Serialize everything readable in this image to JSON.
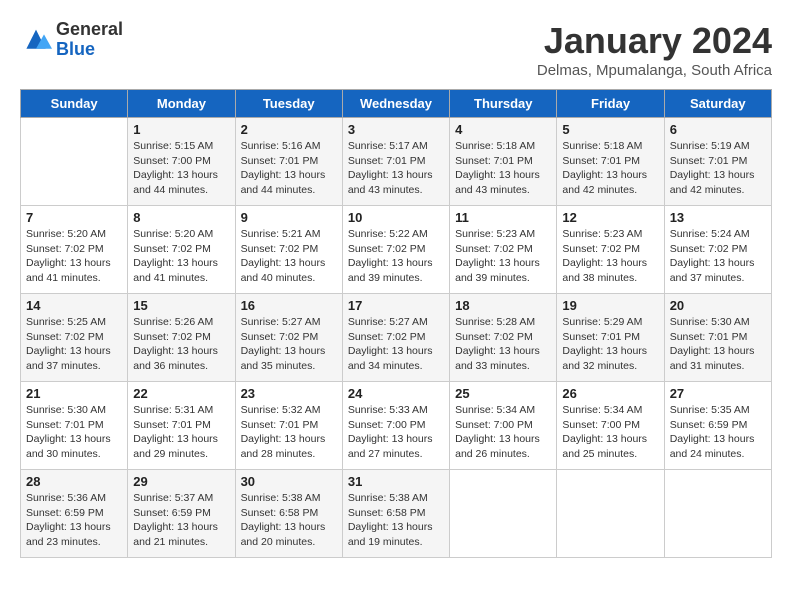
{
  "logo": {
    "general": "General",
    "blue": "Blue"
  },
  "title": "January 2024",
  "location": "Delmas, Mpumalanga, South Africa",
  "days_of_week": [
    "Sunday",
    "Monday",
    "Tuesday",
    "Wednesday",
    "Thursday",
    "Friday",
    "Saturday"
  ],
  "weeks": [
    [
      {
        "day": "",
        "sunrise": "",
        "sunset": "",
        "daylight": ""
      },
      {
        "day": "1",
        "sunrise": "Sunrise: 5:15 AM",
        "sunset": "Sunset: 7:00 PM",
        "daylight": "Daylight: 13 hours and 44 minutes."
      },
      {
        "day": "2",
        "sunrise": "Sunrise: 5:16 AM",
        "sunset": "Sunset: 7:01 PM",
        "daylight": "Daylight: 13 hours and 44 minutes."
      },
      {
        "day": "3",
        "sunrise": "Sunrise: 5:17 AM",
        "sunset": "Sunset: 7:01 PM",
        "daylight": "Daylight: 13 hours and 43 minutes."
      },
      {
        "day": "4",
        "sunrise": "Sunrise: 5:18 AM",
        "sunset": "Sunset: 7:01 PM",
        "daylight": "Daylight: 13 hours and 43 minutes."
      },
      {
        "day": "5",
        "sunrise": "Sunrise: 5:18 AM",
        "sunset": "Sunset: 7:01 PM",
        "daylight": "Daylight: 13 hours and 42 minutes."
      },
      {
        "day": "6",
        "sunrise": "Sunrise: 5:19 AM",
        "sunset": "Sunset: 7:01 PM",
        "daylight": "Daylight: 13 hours and 42 minutes."
      }
    ],
    [
      {
        "day": "7",
        "sunrise": "Sunrise: 5:20 AM",
        "sunset": "Sunset: 7:02 PM",
        "daylight": "Daylight: 13 hours and 41 minutes."
      },
      {
        "day": "8",
        "sunrise": "Sunrise: 5:20 AM",
        "sunset": "Sunset: 7:02 PM",
        "daylight": "Daylight: 13 hours and 41 minutes."
      },
      {
        "day": "9",
        "sunrise": "Sunrise: 5:21 AM",
        "sunset": "Sunset: 7:02 PM",
        "daylight": "Daylight: 13 hours and 40 minutes."
      },
      {
        "day": "10",
        "sunrise": "Sunrise: 5:22 AM",
        "sunset": "Sunset: 7:02 PM",
        "daylight": "Daylight: 13 hours and 39 minutes."
      },
      {
        "day": "11",
        "sunrise": "Sunrise: 5:23 AM",
        "sunset": "Sunset: 7:02 PM",
        "daylight": "Daylight: 13 hours and 39 minutes."
      },
      {
        "day": "12",
        "sunrise": "Sunrise: 5:23 AM",
        "sunset": "Sunset: 7:02 PM",
        "daylight": "Daylight: 13 hours and 38 minutes."
      },
      {
        "day": "13",
        "sunrise": "Sunrise: 5:24 AM",
        "sunset": "Sunset: 7:02 PM",
        "daylight": "Daylight: 13 hours and 37 minutes."
      }
    ],
    [
      {
        "day": "14",
        "sunrise": "Sunrise: 5:25 AM",
        "sunset": "Sunset: 7:02 PM",
        "daylight": "Daylight: 13 hours and 37 minutes."
      },
      {
        "day": "15",
        "sunrise": "Sunrise: 5:26 AM",
        "sunset": "Sunset: 7:02 PM",
        "daylight": "Daylight: 13 hours and 36 minutes."
      },
      {
        "day": "16",
        "sunrise": "Sunrise: 5:27 AM",
        "sunset": "Sunset: 7:02 PM",
        "daylight": "Daylight: 13 hours and 35 minutes."
      },
      {
        "day": "17",
        "sunrise": "Sunrise: 5:27 AM",
        "sunset": "Sunset: 7:02 PM",
        "daylight": "Daylight: 13 hours and 34 minutes."
      },
      {
        "day": "18",
        "sunrise": "Sunrise: 5:28 AM",
        "sunset": "Sunset: 7:02 PM",
        "daylight": "Daylight: 13 hours and 33 minutes."
      },
      {
        "day": "19",
        "sunrise": "Sunrise: 5:29 AM",
        "sunset": "Sunset: 7:01 PM",
        "daylight": "Daylight: 13 hours and 32 minutes."
      },
      {
        "day": "20",
        "sunrise": "Sunrise: 5:30 AM",
        "sunset": "Sunset: 7:01 PM",
        "daylight": "Daylight: 13 hours and 31 minutes."
      }
    ],
    [
      {
        "day": "21",
        "sunrise": "Sunrise: 5:30 AM",
        "sunset": "Sunset: 7:01 PM",
        "daylight": "Daylight: 13 hours and 30 minutes."
      },
      {
        "day": "22",
        "sunrise": "Sunrise: 5:31 AM",
        "sunset": "Sunset: 7:01 PM",
        "daylight": "Daylight: 13 hours and 29 minutes."
      },
      {
        "day": "23",
        "sunrise": "Sunrise: 5:32 AM",
        "sunset": "Sunset: 7:01 PM",
        "daylight": "Daylight: 13 hours and 28 minutes."
      },
      {
        "day": "24",
        "sunrise": "Sunrise: 5:33 AM",
        "sunset": "Sunset: 7:00 PM",
        "daylight": "Daylight: 13 hours and 27 minutes."
      },
      {
        "day": "25",
        "sunrise": "Sunrise: 5:34 AM",
        "sunset": "Sunset: 7:00 PM",
        "daylight": "Daylight: 13 hours and 26 minutes."
      },
      {
        "day": "26",
        "sunrise": "Sunrise: 5:34 AM",
        "sunset": "Sunset: 7:00 PM",
        "daylight": "Daylight: 13 hours and 25 minutes."
      },
      {
        "day": "27",
        "sunrise": "Sunrise: 5:35 AM",
        "sunset": "Sunset: 6:59 PM",
        "daylight": "Daylight: 13 hours and 24 minutes."
      }
    ],
    [
      {
        "day": "28",
        "sunrise": "Sunrise: 5:36 AM",
        "sunset": "Sunset: 6:59 PM",
        "daylight": "Daylight: 13 hours and 23 minutes."
      },
      {
        "day": "29",
        "sunrise": "Sunrise: 5:37 AM",
        "sunset": "Sunset: 6:59 PM",
        "daylight": "Daylight: 13 hours and 21 minutes."
      },
      {
        "day": "30",
        "sunrise": "Sunrise: 5:38 AM",
        "sunset": "Sunset: 6:58 PM",
        "daylight": "Daylight: 13 hours and 20 minutes."
      },
      {
        "day": "31",
        "sunrise": "Sunrise: 5:38 AM",
        "sunset": "Sunset: 6:58 PM",
        "daylight": "Daylight: 13 hours and 19 minutes."
      },
      {
        "day": "",
        "sunrise": "",
        "sunset": "",
        "daylight": ""
      },
      {
        "day": "",
        "sunrise": "",
        "sunset": "",
        "daylight": ""
      },
      {
        "day": "",
        "sunrise": "",
        "sunset": "",
        "daylight": ""
      }
    ]
  ]
}
